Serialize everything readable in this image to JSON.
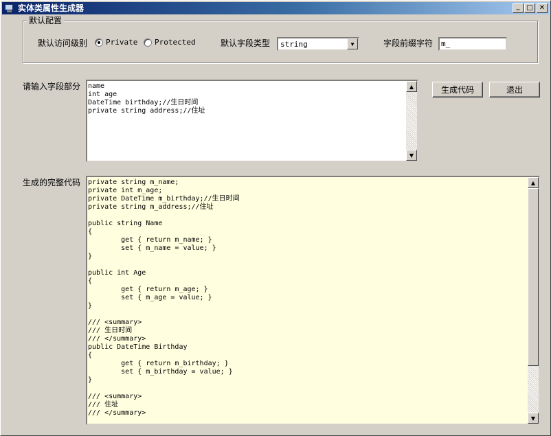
{
  "window": {
    "title": "实体类属性生成器",
    "controls": {
      "minimize": "_",
      "maximize": "□",
      "close": "✕"
    }
  },
  "default_config": {
    "legend": "默认配置",
    "access_label": "默认访问级别",
    "access_options": [
      {
        "label": "Private",
        "checked": true
      },
      {
        "label": "Protected",
        "checked": false
      }
    ],
    "type_label": "默认字段类型",
    "type_value": "string",
    "prefix_label": "字段前缀字符",
    "prefix_value": "m_"
  },
  "input_section": {
    "label": "请输入字段部分",
    "text": "name\nint age\nDateTime birthday;//生日时间\nprivate string address;//住址"
  },
  "buttons": {
    "generate": "生成代码",
    "exit": "退出"
  },
  "output_section": {
    "label": "生成的完整代码",
    "text": "private string m_name;\nprivate int m_age;\nprivate DateTime m_birthday;//生日时间\nprivate string m_address;//住址\n\npublic string Name\n{\n        get { return m_name; }\n        set { m_name = value; }\n}\n\npublic int Age\n{\n        get { return m_age; }\n        set { m_age = value; }\n}\n\n/// <summary>\n/// 生日时间\n/// </summary>\npublic DateTime Birthday\n{\n        get { return m_birthday; }\n        set { m_birthday = value; }\n}\n\n/// <summary>\n/// 住址\n/// </summary>"
  },
  "colors": {
    "window_bg": "#d4d0c8",
    "titlebar_start": "#0a246a",
    "titlebar_end": "#a6caf0",
    "output_bg": "#ffffe0"
  }
}
